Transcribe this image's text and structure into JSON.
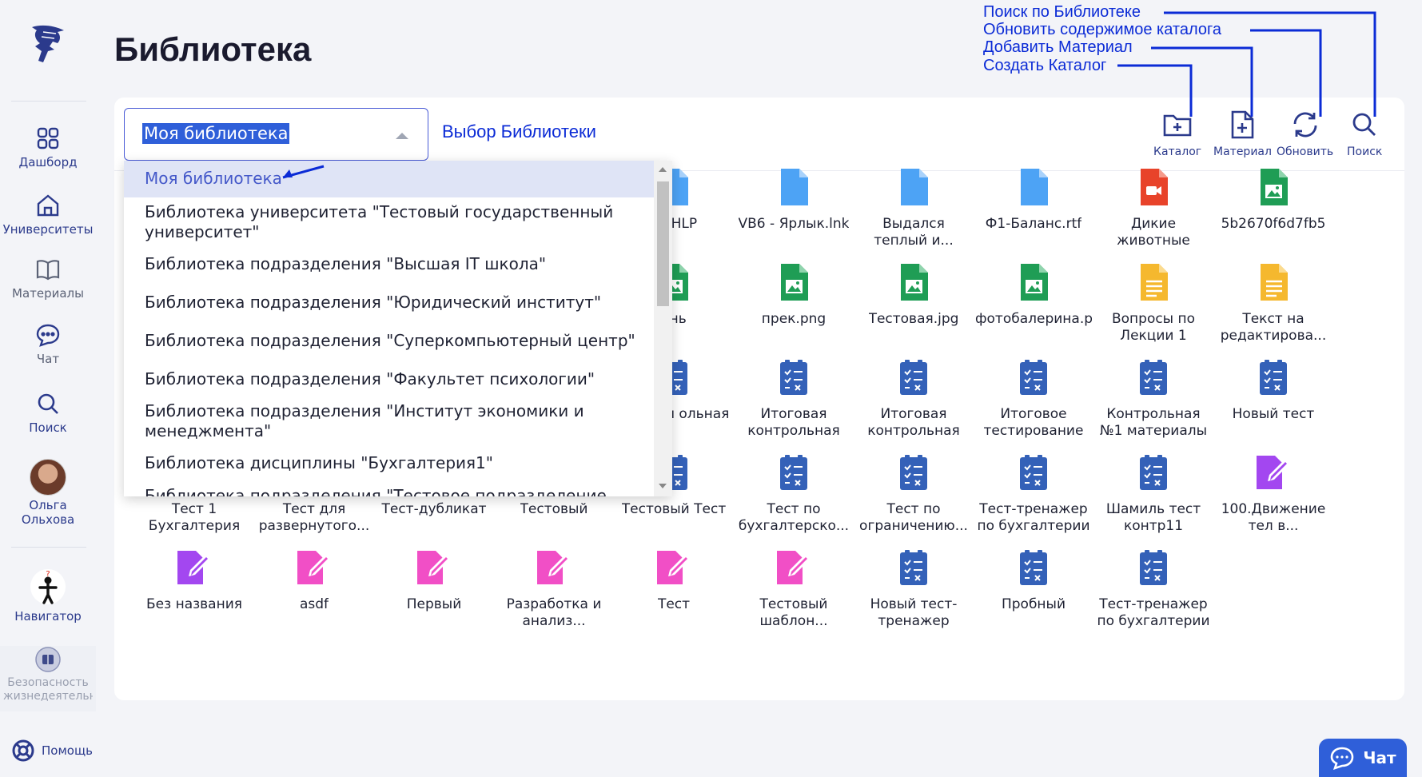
{
  "colors": {
    "accent": "#2f5fd9",
    "annotation": "#0b2bd6",
    "nav": "#2b3a8c"
  },
  "sidebar": {
    "items": [
      {
        "label": "Дашборд",
        "icon": "dashboard-icon"
      },
      {
        "label": "Университеты",
        "icon": "university-icon"
      },
      {
        "label": "Материалы",
        "icon": "book-icon"
      },
      {
        "label": "Чат",
        "icon": "chat-icon"
      },
      {
        "label": "Поиск",
        "icon": "search-icon"
      }
    ],
    "user": {
      "first": "Ольга",
      "last": "Ольхова"
    },
    "navigator": "Навигатор",
    "course": "Безопасность жизнедеятельн",
    "help": "Помощь"
  },
  "page": {
    "title": "Библиотека"
  },
  "annotations": {
    "search": "Поиск по Библиотеке",
    "refresh": "Обновить содержимое каталога",
    "add": "Добавить Материал",
    "create": "Создать Каталог",
    "select_hint": "Выбор Библиотеки"
  },
  "library_select": {
    "value": "Моя библиотека"
  },
  "toolbar": {
    "catalog": "Каталог",
    "material": "Материал",
    "refresh": "Обновить",
    "search": "Поиск"
  },
  "dropdown": {
    "options": [
      "Моя библиотека",
      "Библиотека университета \"Тестовый государственный университет\"",
      "Библиотека подразделения \"Высшая IT школа\"",
      "Библиотека подразделения \"Юридический институт\"",
      "Библиотека подразделения \"Суперкомпьютерный центр\"",
      "Библиотека подразделения \"Факультет психологии\"",
      "Библиотека подразделения \"Институт экономики и менеджмента\"",
      "Библиотека дисциплины \"Бухгалтерия1\"",
      "Библиотека подразделения \"Тестовое подразделение"
    ]
  },
  "files": {
    "row1": [
      {
        "label": "RV.HLP",
        "type": "doc-blue"
      },
      {
        "label": "VB6 - Ярлык.lnk",
        "type": "doc-blue"
      },
      {
        "label": "Выдался теплый и...",
        "type": "doc-blue"
      },
      {
        "label": "Ф1-Баланс.rtf",
        "type": "doc-blue"
      },
      {
        "label": "Дикие животные",
        "type": "video-red"
      },
      {
        "label": "5b2670f6d7fb5",
        "type": "image-green"
      }
    ],
    "row2": [
      {
        "label": "онь",
        "type": "image-green"
      },
      {
        "label": "прек.png",
        "type": "image-green"
      },
      {
        "label": "Тестовая.jpg",
        "type": "image-green"
      },
      {
        "label": "фотобалерина.p",
        "type": "image-green"
      },
      {
        "label": "Вопросы по Лекции 1",
        "type": "text-yellow"
      },
      {
        "label": "Текст на редактирова...",
        "type": "text-yellow"
      }
    ],
    "row3": [
      {
        "label": "тоговая ольная",
        "type": "test-blue"
      },
      {
        "label": "Итоговая контрольная",
        "type": "test-blue"
      },
      {
        "label": "Итоговая контрольная",
        "type": "test-blue"
      },
      {
        "label": "Итоговое тестирование",
        "type": "test-blue"
      },
      {
        "label": "Контрольная №1 материалы",
        "type": "test-blue"
      },
      {
        "label": "Новый тест",
        "type": "test-blue"
      }
    ],
    "row4": [
      {
        "label": "Тест 1 Бухгалтерия",
        "type": "test-blue"
      },
      {
        "label": "Тест для развернутого...",
        "type": "test-blue"
      },
      {
        "label": "Тест-дубликат",
        "type": "test-blue"
      },
      {
        "label": "Тестовый",
        "type": "test-blue"
      },
      {
        "label": "Тестовый Тест",
        "type": "test-blue"
      },
      {
        "label": "Тест по бухгалтерско...",
        "type": "test-blue"
      },
      {
        "label": "Тест по ограничению...",
        "type": "test-blue"
      },
      {
        "label": "Тест-тренажер по бухгалтерии",
        "type": "test-blue"
      },
      {
        "label": "Шамиль тест контр11",
        "type": "test-blue"
      },
      {
        "label": "100.Движение тел в...",
        "type": "edit-purple"
      }
    ],
    "row5": [
      {
        "label": "Без названия",
        "type": "edit-purple"
      },
      {
        "label": "asdf",
        "type": "edit-pink"
      },
      {
        "label": "Первый",
        "type": "edit-pink"
      },
      {
        "label": "Разработка и анализ...",
        "type": "edit-pink"
      },
      {
        "label": "Тест",
        "type": "edit-pink"
      },
      {
        "label": "Тестовый шаблон...",
        "type": "edit-pink"
      },
      {
        "label": "Новый тест-тренажер",
        "type": "test-blue"
      },
      {
        "label": "Пробный",
        "type": "test-blue"
      },
      {
        "label": "Тест-тренажер по бухгалтерии",
        "type": "test-blue"
      }
    ]
  },
  "chat_button": {
    "label": "Чат"
  }
}
